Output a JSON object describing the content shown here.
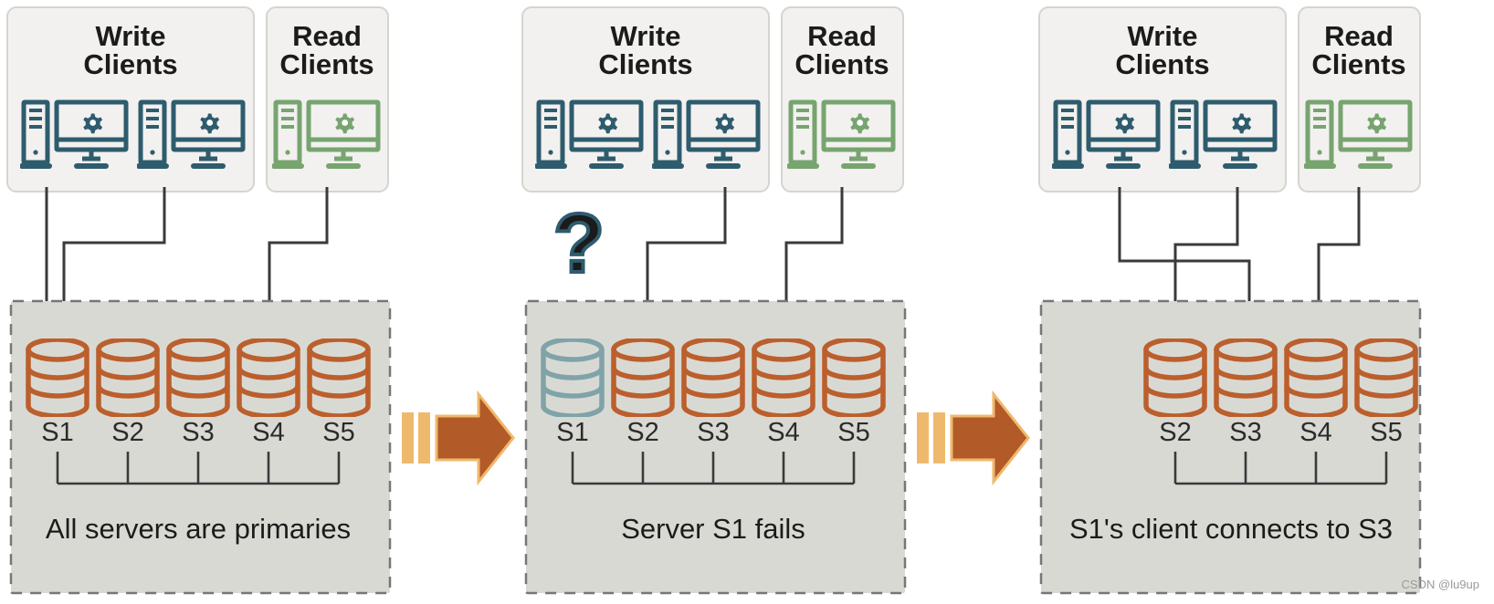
{
  "colors": {
    "write_client": "#2e5c6e",
    "read_client": "#77a46f",
    "db_primary": "#bb5f2c",
    "db_failed": "#7fa3a8",
    "panel_bg": "#d9d9d4",
    "panel_border": "#777777",
    "clientbox_bg": "#f2f1ef",
    "clientbox_border": "#d6d4d0",
    "arrow_line": "#3a3a3a",
    "step_arrow": "#b25a28",
    "step_arrow_light": "#efb96d",
    "question_mark": "#2e5c6e",
    "text": "#1b1b1b"
  },
  "panels": [
    {
      "id": "panel-1",
      "write_clients": {
        "label_line1": "Write",
        "label_line2": "Clients",
        "count": 2
      },
      "read_clients": {
        "label_line1": "Read",
        "label_line2": "Clients",
        "count": 1
      },
      "servers": [
        {
          "name": "S1",
          "state": "primary"
        },
        {
          "name": "S2",
          "state": "primary"
        },
        {
          "name": "S3",
          "state": "primary"
        },
        {
          "name": "S4",
          "state": "primary"
        },
        {
          "name": "S5",
          "state": "primary"
        }
      ],
      "caption": "All servers are primaries",
      "show_question_mark": false,
      "connections": [
        {
          "from": "write-client-1",
          "to": "S1",
          "type": "write"
        },
        {
          "from": "write-client-2",
          "to": "S1",
          "type": "write"
        },
        {
          "from": "read-client-1",
          "to": "S4",
          "type": "read"
        }
      ]
    },
    {
      "id": "panel-2",
      "write_clients": {
        "label_line1": "Write",
        "label_line2": "Clients",
        "count": 2
      },
      "read_clients": {
        "label_line1": "Read",
        "label_line2": "Clients",
        "count": 1
      },
      "servers": [
        {
          "name": "S1",
          "state": "failed"
        },
        {
          "name": "S2",
          "state": "primary"
        },
        {
          "name": "S3",
          "state": "primary"
        },
        {
          "name": "S4",
          "state": "primary"
        },
        {
          "name": "S5",
          "state": "primary"
        }
      ],
      "caption": "Server S1 fails",
      "show_question_mark": true,
      "question_mark": "?",
      "connections": [
        {
          "from": "write-client-2",
          "to": "S2",
          "type": "write"
        },
        {
          "from": "read-client-1",
          "to": "S4",
          "type": "read"
        }
      ]
    },
    {
      "id": "panel-3",
      "write_clients": {
        "label_line1": "Write",
        "label_line2": "Clients",
        "count": 2
      },
      "read_clients": {
        "label_line1": "Read",
        "label_line2": "Clients",
        "count": 1
      },
      "servers": [
        {
          "name": "S2",
          "state": "primary"
        },
        {
          "name": "S3",
          "state": "primary"
        },
        {
          "name": "S4",
          "state": "primary"
        },
        {
          "name": "S5",
          "state": "primary"
        }
      ],
      "caption": "S1's client connects to S3",
      "show_question_mark": false,
      "connections": [
        {
          "from": "write-client-1",
          "to": "S3",
          "type": "write"
        },
        {
          "from": "write-client-2",
          "to": "S2",
          "type": "write"
        },
        {
          "from": "read-client-1",
          "to": "S4",
          "type": "read"
        }
      ]
    }
  ],
  "step_arrows": [
    {
      "id": "step-arrow-1",
      "from_panel": "panel-1",
      "to_panel": "panel-2"
    },
    {
      "id": "step-arrow-2",
      "from_panel": "panel-2",
      "to_panel": "panel-3"
    }
  ],
  "watermark": "CSDN @lu9up"
}
